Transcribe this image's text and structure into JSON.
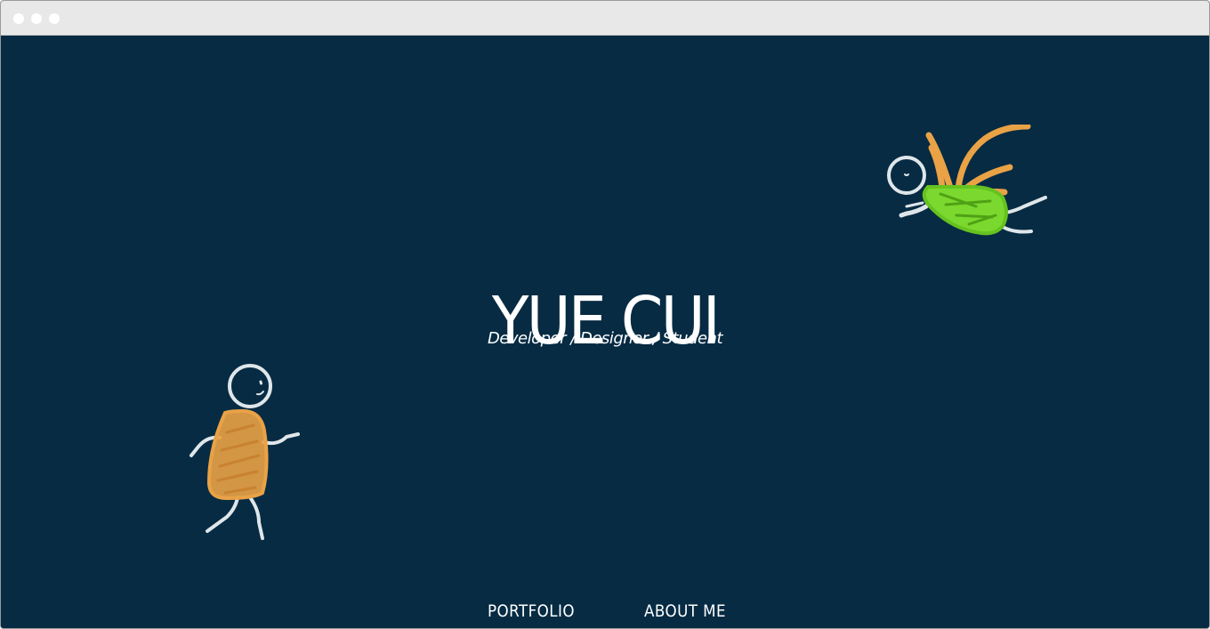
{
  "hero": {
    "title": "YUE CUI",
    "subtitle": "Developer / Designer / Student"
  },
  "nav": {
    "portfolio": "PORTFOLIO",
    "about": "ABOUT ME"
  },
  "colors": {
    "background": "#062b43",
    "text": "#ffffff",
    "accent_orange": "#e9a246",
    "accent_green": "#7bd82e",
    "chalk_white": "#dfe6ea"
  },
  "icons": {
    "walker": "chalk-stick-figure-walking-icon",
    "flyer": "chalk-stick-figure-flying-icon"
  }
}
